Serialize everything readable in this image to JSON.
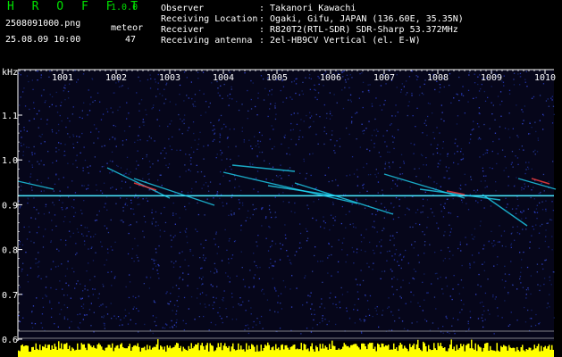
{
  "header": {
    "app_name": "H R O F F T",
    "version": "1.0.0",
    "filename": "2508091000.png",
    "datetime": "25.08.09 10:00",
    "meteor_label": "meteor",
    "meteor_count": "47"
  },
  "meta": [
    {
      "label": "Observer",
      "value": ": Takanori Kawachi"
    },
    {
      "label": "Receiving Location",
      "value": ": Ogaki, Gifu, JAPAN (136.60E, 35.35N)"
    },
    {
      "label": "Receiver",
      "value": ": R820T2(RTL-SDR) SDR-Sharp 53.372MHz"
    },
    {
      "label": "Receiving antenna",
      "value": ": 2el-HB9CV Vertical (el. E-W)"
    }
  ],
  "chart_data": {
    "type": "heatmap",
    "ylabel": "kHz",
    "x_ticks": [
      "1001",
      "1002",
      "1003",
      "1004",
      "1005",
      "1006",
      "1007",
      "1008",
      "1009",
      "1010"
    ],
    "y_ticks": [
      "1.1",
      "1.0",
      "0.9",
      "0.8",
      "0.7",
      "0.6"
    ],
    "ylim": [
      0.6,
      1.1
    ],
    "carrier_khz": 0.92,
    "colors": {
      "background": "#06061a",
      "axis": "#ffffff",
      "signal": "#20e0ff",
      "hot": "#ff4040",
      "bar": "#ffff00"
    }
  }
}
